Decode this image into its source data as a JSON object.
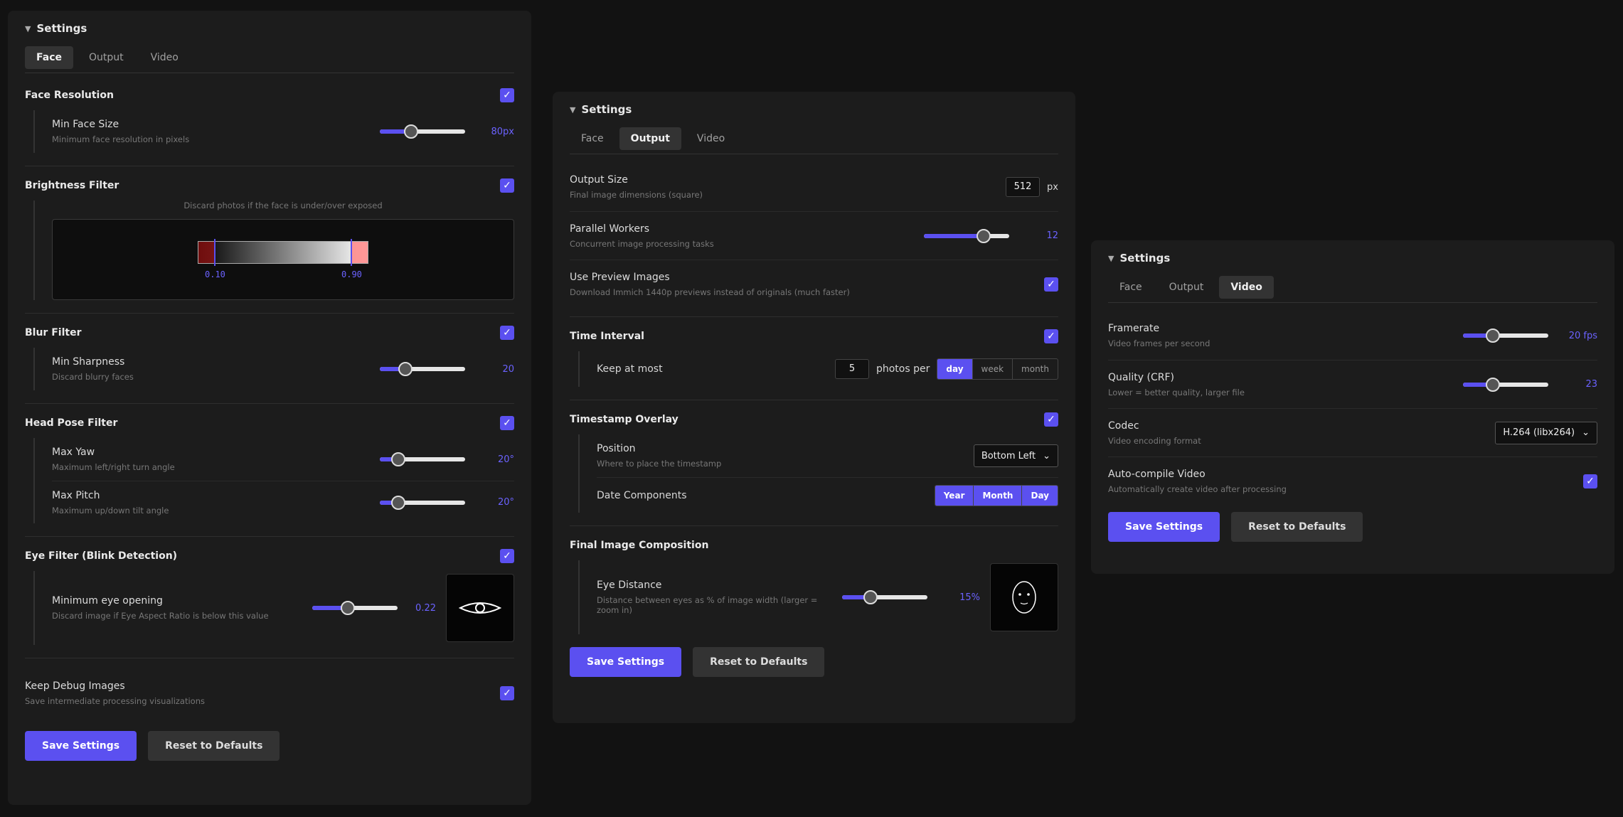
{
  "panel1": {
    "title": "Settings",
    "tabs": [
      "Face",
      "Output",
      "Video"
    ],
    "sections": {
      "face_resolution": {
        "title": "Face Resolution",
        "min_size_label": "Min Face Size",
        "min_size_desc": "Minimum face resolution in pixels",
        "min_size_value": "80px",
        "min_size_level": 0.37
      },
      "brightness": {
        "title": "Brightness Filter",
        "desc": "Discard photos if the face is under/over exposed",
        "low": "0.10",
        "high": "0.90"
      },
      "blur": {
        "title": "Blur Filter",
        "label": "Min Sharpness",
        "desc": "Discard blurry faces",
        "value": "20",
        "level": 0.3
      },
      "head_pose": {
        "title": "Head Pose Filter",
        "yaw_label": "Max Yaw",
        "yaw_desc": "Maximum left/right turn angle",
        "yaw_value": "20°",
        "yaw_level": 0.22,
        "pitch_label": "Max Pitch",
        "pitch_desc": "Maximum up/down tilt angle",
        "pitch_value": "20°",
        "pitch_level": 0.22
      },
      "eye": {
        "title": "Eye Filter (Blink Detection)",
        "label": "Minimum eye opening",
        "desc": "Discard image if Eye Aspect Ratio is below this value",
        "value": "0.22",
        "level": 0.42
      },
      "debug": {
        "label": "Keep Debug Images",
        "desc": "Save intermediate processing visualizations"
      }
    },
    "save": "Save Settings",
    "reset": "Reset to Defaults"
  },
  "panel2": {
    "title": "Settings",
    "tabs": [
      "Face",
      "Output",
      "Video"
    ],
    "output_size": {
      "label": "Output Size",
      "desc": "Final image dimensions (square)",
      "value": "512",
      "unit": "px"
    },
    "workers": {
      "label": "Parallel Workers",
      "desc": "Concurrent image processing tasks",
      "value": "12",
      "level": 0.7
    },
    "preview": {
      "label": "Use Preview Images",
      "desc": "Download Immich 1440p previews instead of originals (much faster)"
    },
    "time_interval": {
      "title": "Time Interval",
      "label": "Keep at most",
      "count": "5",
      "per": "photos per",
      "options": [
        "day",
        "week",
        "month"
      ]
    },
    "timestamp": {
      "title": "Timestamp Overlay",
      "pos_label": "Position",
      "pos_desc": "Where to place the timestamp",
      "pos_value": "Bottom Left",
      "date_label": "Date Components",
      "date_opts": [
        "Year",
        "Month",
        "Day"
      ]
    },
    "composition": {
      "title": "Final Image Composition",
      "label": "Eye Distance",
      "desc": "Distance between eyes as % of image width (larger = zoom in)",
      "value": "15%",
      "level": 0.33
    },
    "save": "Save Settings",
    "reset": "Reset to Defaults"
  },
  "panel3": {
    "title": "Settings",
    "tabs": [
      "Face",
      "Output",
      "Video"
    ],
    "framerate": {
      "label": "Framerate",
      "desc": "Video frames per second",
      "value": "20 fps",
      "level": 0.35
    },
    "quality": {
      "label": "Quality (CRF)",
      "desc": "Lower = better quality, larger file",
      "value": "23",
      "level": 0.35
    },
    "codec": {
      "label": "Codec",
      "desc": "Video encoding format",
      "value": "H.264 (libx264)"
    },
    "autocompile": {
      "label": "Auto-compile Video",
      "desc": "Automatically create video after processing"
    },
    "save": "Save Settings",
    "reset": "Reset to Defaults"
  },
  "colors": {
    "accent": "#5b50f0",
    "background": "#121212",
    "panel": "#1c1c1c"
  }
}
